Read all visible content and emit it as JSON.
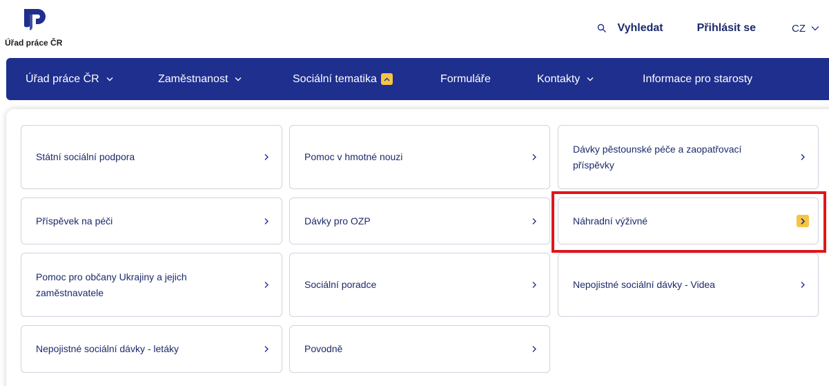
{
  "header": {
    "logo_text": "Úřad práce ČR",
    "search_label": "Vyhledat",
    "login_label": "Přihlásit se",
    "language": "CZ"
  },
  "nav": {
    "items": [
      {
        "label": "Úřad práce ČR"
      },
      {
        "label": "Zaměstnanost"
      },
      {
        "label": "Sociální tematika"
      },
      {
        "label": "Formuláře"
      },
      {
        "label": "Kontakty"
      },
      {
        "label": "Informace pro starosty"
      }
    ]
  },
  "menu": {
    "cards": [
      {
        "label": "Státní sociální podpora"
      },
      {
        "label": "Pomoc v hmotné nouzi"
      },
      {
        "label": "Dávky pěstounské péče a zaopatřovací příspěvky"
      },
      {
        "label": "Příspěvek na péči"
      },
      {
        "label": "Dávky pro OZP"
      },
      {
        "label": "Náhradní výživné",
        "active": true
      },
      {
        "label": "Pomoc pro občany Ukrajiny a jejich zaměstnavatele"
      },
      {
        "label": "Sociální poradce"
      },
      {
        "label": "Nepojistné sociální dávky - Videa"
      },
      {
        "label": "Nepojistné sociální dávky - letáky"
      },
      {
        "label": "Povodně"
      }
    ]
  },
  "colors": {
    "nav_bg": "#1e2f8e",
    "text_primary": "#1b2a6b",
    "accent_yellow": "#f6c544",
    "highlight_red": "#e0161b"
  }
}
